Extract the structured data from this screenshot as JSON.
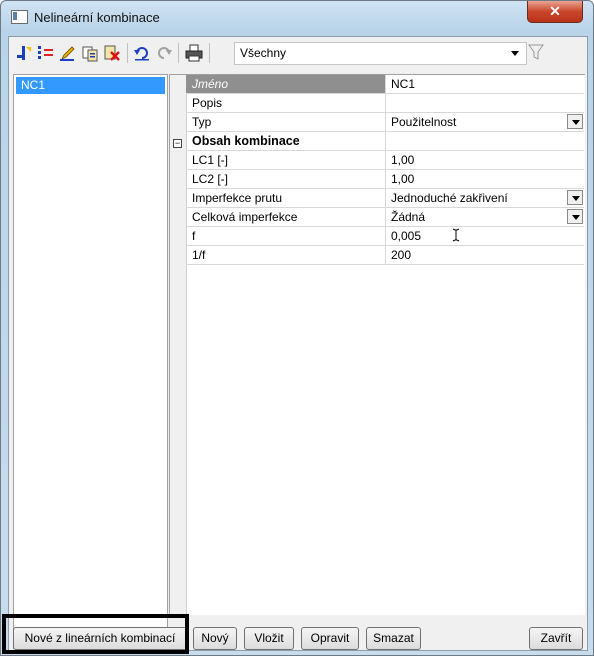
{
  "window": {
    "title": "Nelineární kombinace",
    "close_label": "✕"
  },
  "toolbar": {
    "icons": [
      "new-combination-icon",
      "generate-icon",
      "edit-icon",
      "copy-icon",
      "delete-icon",
      "undo-icon",
      "redo-icon",
      "print-icon",
      "filter-icon"
    ],
    "filter_value": "Všechny"
  },
  "list": {
    "items": [
      "NC1"
    ]
  },
  "properties": {
    "rows": [
      {
        "name": "Jméno",
        "value": "NC1"
      },
      {
        "name": "Popis",
        "value": ""
      },
      {
        "name": "Typ",
        "value": "Použitelnost"
      },
      {
        "name": "Obsah kombinace",
        "value": ""
      },
      {
        "name": "LC1 [-]",
        "value": "1,00"
      },
      {
        "name": "LC2 [-]",
        "value": "1,00"
      },
      {
        "name": "Imperfekce prutu",
        "value": "Jednoduché zakřivení"
      },
      {
        "name": "Celková imperfekce",
        "value": "Žádná"
      },
      {
        "name": "f",
        "value": "0,005"
      },
      {
        "name": "1/f",
        "value": "200"
      }
    ]
  },
  "buttons": {
    "new_from_linear": "Nové z lineárních kombinací",
    "new": "Nový",
    "insert": "Vložit",
    "edit": "Opravit",
    "delete": "Smazat",
    "close": "Zavřít"
  }
}
